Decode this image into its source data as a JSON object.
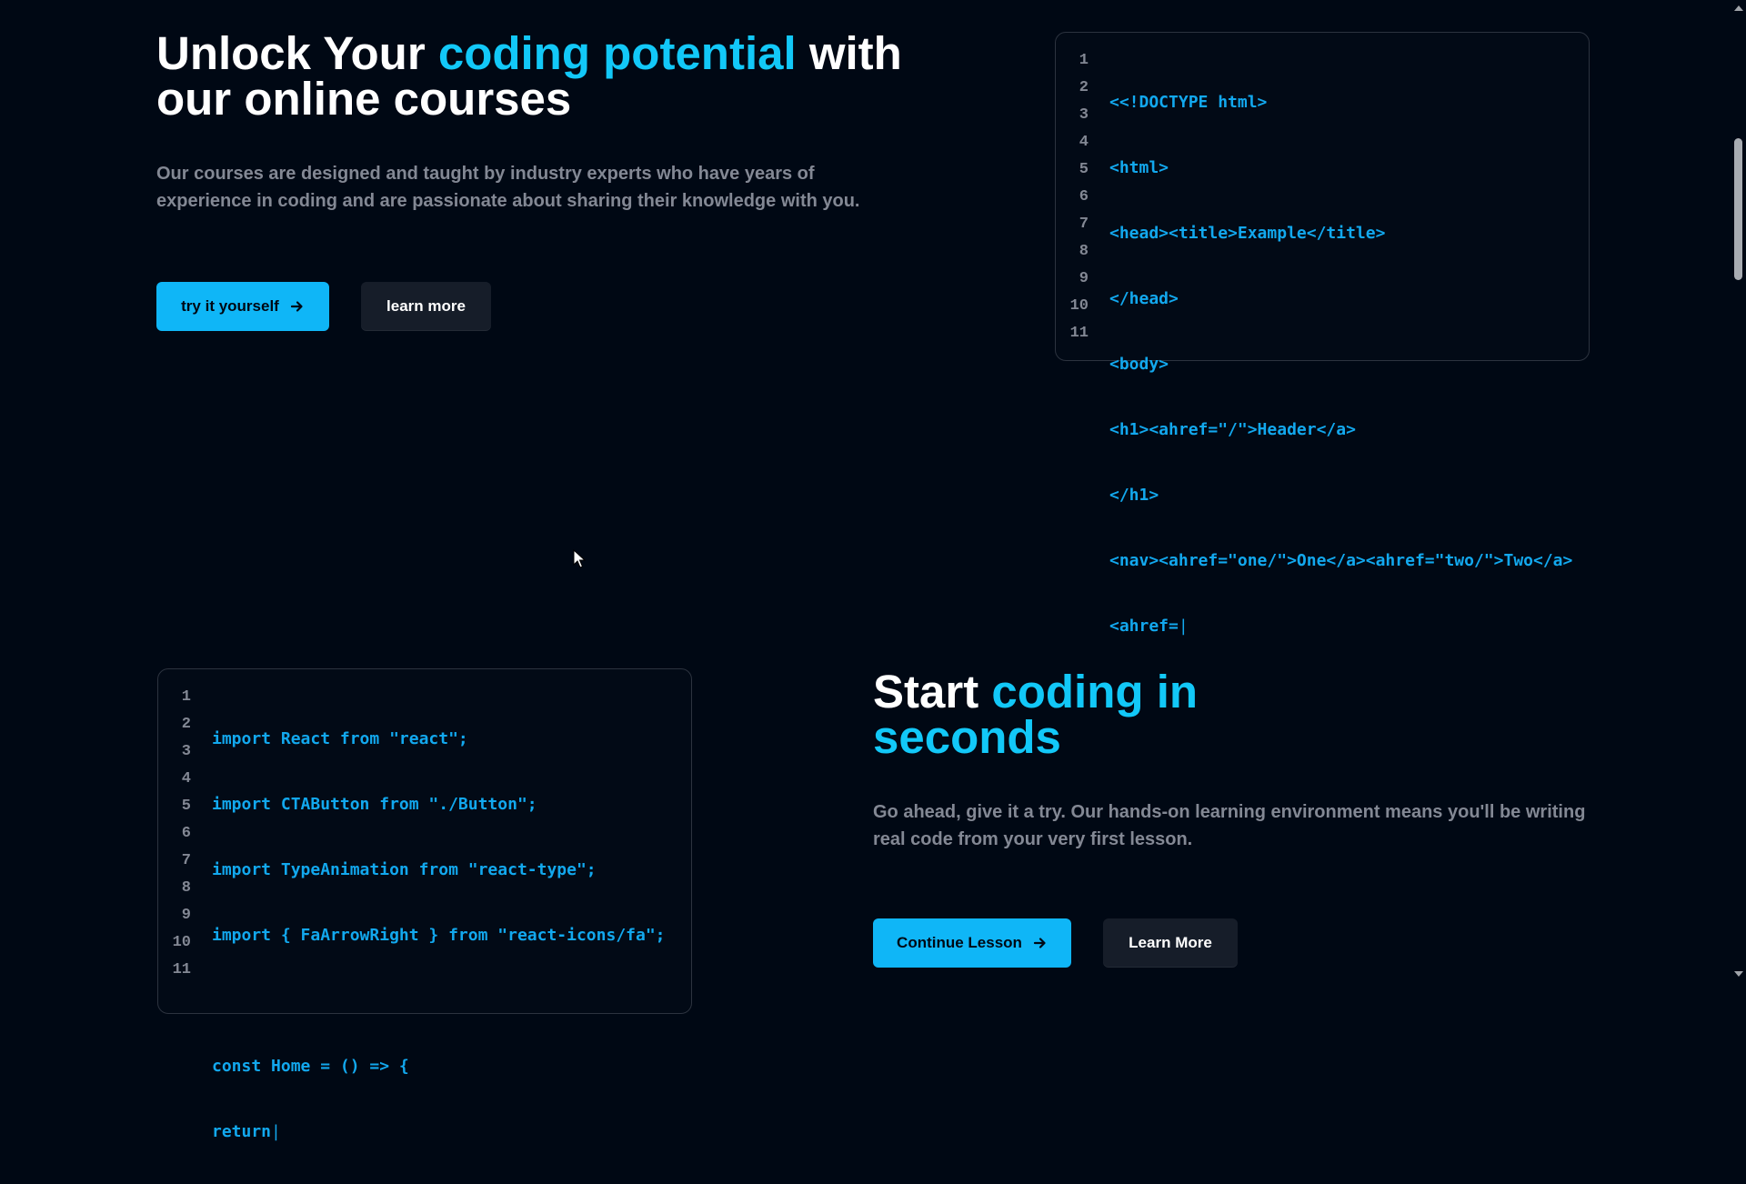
{
  "hero": {
    "heading_part1": "Unlock Your ",
    "heading_accent": "coding potential",
    "heading_part2": " with",
    "heading_line2": "our online courses",
    "description_line1": "Our courses are designed and taught by industry experts who have years of",
    "description_line2": "experience in coding and are passionate about sharing their knowledge with you.",
    "primary_button": "try it yourself",
    "secondary_button": "learn more",
    "code_line_numbers": [
      "1",
      "2",
      "3",
      "4",
      "5",
      "6",
      "7",
      "8",
      "9",
      "10",
      "11"
    ],
    "code_lines": [
      "<<!DOCTYPE html>",
      "<html>",
      "<head><title>Example</title>",
      "</head>",
      "<body>",
      "<h1><ahref=\"/\">Header</a>",
      "</h1>",
      "<nav><ahref=\"one/\">One</a><ahref=\"two/\">Two</a>",
      "<ahref="
    ]
  },
  "section2": {
    "heading_part1": "Start ",
    "heading_accent_line1": "coding in",
    "heading_accent_line2": "seconds",
    "description_line1": "Go ahead, give it a try. Our hands-on learning environment means you'll be writing",
    "description_line2": "real code from your very first lesson.",
    "primary_button": "Continue Lesson",
    "secondary_button": "Learn More",
    "code_line_numbers": [
      "1",
      "2",
      "3",
      "4",
      "5",
      "6",
      "7",
      "8",
      "9",
      "10",
      "11"
    ],
    "code_lines": [
      "import React from \"react\";",
      "import CTAButton from \"./Button\";",
      "import TypeAnimation from \"react-type\";",
      "import { FaArrowRight } from \"react-icons/fa\";",
      "",
      "const Home = () => {",
      "return"
    ]
  },
  "colors": {
    "background": "#000814",
    "accent": "#12c8f8",
    "primary_button": "#0fb6f7",
    "dark_button": "#161d29",
    "muted_text": "#838894"
  },
  "icons": {
    "arrow": "arrow-right-icon",
    "cursor": "mouse-pointer-icon"
  }
}
